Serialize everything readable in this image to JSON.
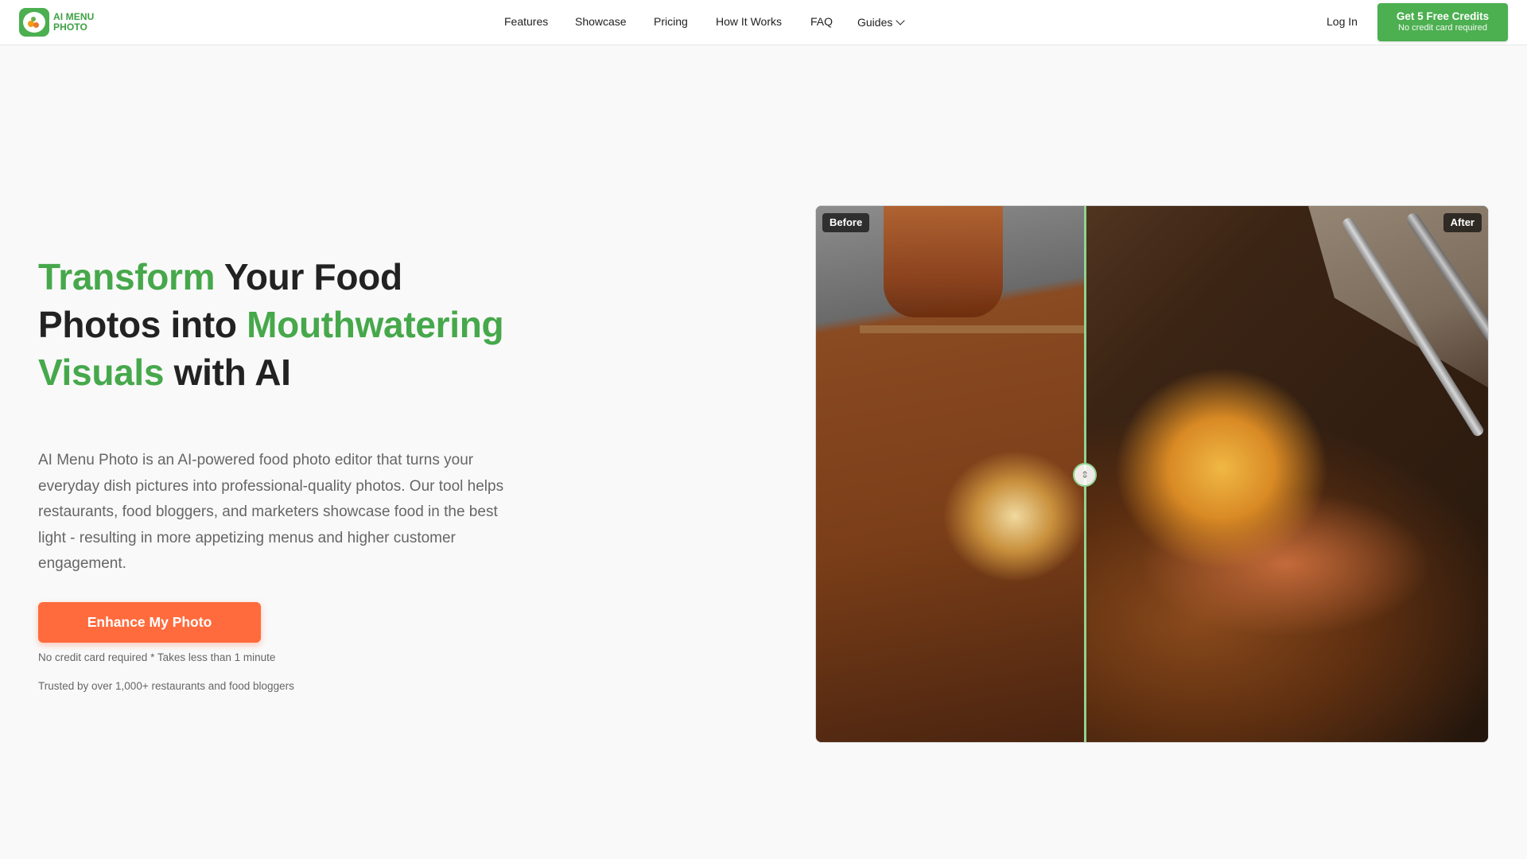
{
  "header": {
    "logo": {
      "line1": "AI MENU",
      "line2": "PHOTO"
    },
    "nav": {
      "features": "Features",
      "showcase": "Showcase",
      "pricing": "Pricing",
      "how_it_works": "How It Works",
      "faq": "FAQ",
      "guides": "Guides"
    },
    "login": "Log In",
    "cta": {
      "title": "Get 5 Free Credits",
      "subtitle": "No credit card required"
    }
  },
  "hero": {
    "title": {
      "part1": "Transform",
      "part2": " Your Food Photos into ",
      "part3": "Mouthwatering Visuals",
      "part4": " with AI"
    },
    "description": "AI Menu Photo is an AI-powered food photo editor that turns your everyday dish pictures into professional-quality photos. Our tool helps restaurants, food bloggers, and marketers showcase food in the best light - resulting in more appetizing menus and higher customer engagement.",
    "button": "Enhance My Photo",
    "note1": "No credit card required * Takes less than 1 minute",
    "note2": "Trusted by over 1,000+ restaurants and food bloggers"
  },
  "comparison": {
    "before_label": "Before",
    "after_label": "After",
    "slider_position": 0.4,
    "handle_icon": "drag-handle-icon"
  },
  "colors": {
    "brand_green": "#4caf50",
    "title_green": "#46a84b",
    "cta_orange": "#ff6b3d",
    "divider_green": "#8fd48f"
  }
}
